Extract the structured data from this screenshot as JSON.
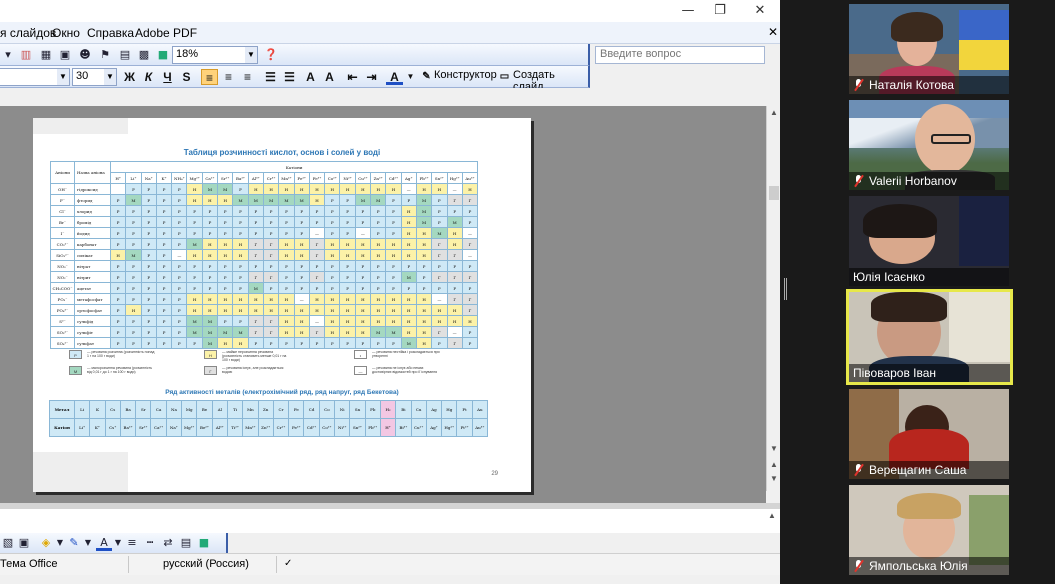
{
  "app": {
    "menu": [
      "я слайдов",
      "Окно",
      "Справка",
      "Adobe PDF"
    ],
    "help_placeholder": "Введите вопрос",
    "zoom": "18%",
    "font_size": "30",
    "designer_label": "Конструктор",
    "new_slide_label": "Создать слайд",
    "status": {
      "theme": "Тема Office",
      "language": "русский (Россия)"
    }
  },
  "slide": {
    "title": "Таблиця розчинності кислот, основ і солей у воді",
    "header_anion": "Аніони",
    "header_name": "Назва аніона",
    "header_cations": "Катіони",
    "cations": [
      "H⁺",
      "Li⁺",
      "Na⁺",
      "K⁺",
      "NH₄⁺",
      "Mg²⁺",
      "Ca²⁺",
      "Sr²⁺",
      "Ba²⁺",
      "Al³⁺",
      "Cr³⁺",
      "Mn²⁺",
      "Fe²⁺",
      "Fe³⁺",
      "Co²⁺",
      "Ni²⁺",
      "Cu²⁺",
      "Zn²⁺",
      "Cd²⁺",
      "Ag⁺",
      "Pb²⁺",
      "Sn²⁺",
      "Hg²⁺",
      "Au³⁺"
    ],
    "rows": [
      {
        "anion": "OH⁻",
        "name": "гідроксид",
        "cells": [
          "",
          "Р",
          "Р",
          "Р",
          "Р",
          "Н",
          "М",
          "М",
          "Р",
          "Н",
          "Н",
          "Н",
          "Н",
          "Н",
          "Н",
          "Н",
          "Н",
          "Н",
          "Н",
          "—",
          "Н",
          "Н",
          "—",
          "Н"
        ]
      },
      {
        "anion": "F⁻",
        "name": "фторид",
        "cells": [
          "Р",
          "М",
          "Р",
          "Р",
          "Р",
          "Н",
          "Н",
          "Н",
          "М",
          "М",
          "М",
          "М",
          "М",
          "Н",
          "Р",
          "Р",
          "М",
          "М",
          "Р",
          "Р",
          "М",
          "Р",
          "Г",
          "Г"
        ]
      },
      {
        "anion": "Cl⁻",
        "name": "хлорид",
        "cells": [
          "Р",
          "Р",
          "Р",
          "Р",
          "Р",
          "Р",
          "Р",
          "Р",
          "Р",
          "Р",
          "Р",
          "Р",
          "Р",
          "Р",
          "Р",
          "Р",
          "Р",
          "Р",
          "Р",
          "Н",
          "М",
          "Р",
          "Р",
          "Р"
        ]
      },
      {
        "anion": "Br⁻",
        "name": "бромід",
        "cells": [
          "Р",
          "Р",
          "Р",
          "Р",
          "Р",
          "Р",
          "Р",
          "Р",
          "Р",
          "Р",
          "Р",
          "Р",
          "Р",
          "Р",
          "Р",
          "Р",
          "Р",
          "Р",
          "Р",
          "Н",
          "М",
          "Р",
          "М",
          "Р"
        ]
      },
      {
        "anion": "I⁻",
        "name": "йодид",
        "cells": [
          "Р",
          "Р",
          "Р",
          "Р",
          "Р",
          "Р",
          "Р",
          "Р",
          "Р",
          "Р",
          "Р",
          "Р",
          "Р",
          "—",
          "Р",
          "Р",
          "—",
          "Р",
          "Р",
          "Н",
          "Н",
          "М",
          "Н",
          "—"
        ]
      },
      {
        "anion": "CO₃²⁻",
        "name": "карбонат",
        "cells": [
          "Р",
          "Р",
          "Р",
          "Р",
          "Р",
          "М",
          "Н",
          "Н",
          "Н",
          "Г",
          "Г",
          "Н",
          "Н",
          "Г",
          "Н",
          "Н",
          "Н",
          "Н",
          "Н",
          "Н",
          "Н",
          "Г",
          "Н",
          "Г"
        ]
      },
      {
        "anion": "SiO₃²⁻",
        "name": "силікат",
        "cells": [
          "Н",
          "М",
          "Р",
          "Р",
          "—",
          "Н",
          "Н",
          "Н",
          "Н",
          "Г",
          "Г",
          "Н",
          "Н",
          "Г",
          "Н",
          "Н",
          "Н",
          "Н",
          "Н",
          "Н",
          "Н",
          "Г",
          "Г",
          "—"
        ]
      },
      {
        "anion": "NO₃⁻",
        "name": "нітрат",
        "cells": [
          "Р",
          "Р",
          "Р",
          "Р",
          "Р",
          "Р",
          "Р",
          "Р",
          "Р",
          "Р",
          "Р",
          "Р",
          "Р",
          "Р",
          "Р",
          "Р",
          "Р",
          "Р",
          "Р",
          "Р",
          "Р",
          "Р",
          "Р",
          "Р"
        ]
      },
      {
        "anion": "NO₂⁻",
        "name": "нітрит",
        "cells": [
          "Р",
          "Р",
          "Р",
          "Р",
          "Р",
          "Р",
          "Р",
          "Р",
          "Р",
          "Г",
          "Г",
          "Р",
          "Р",
          "Г",
          "Р",
          "Р",
          "Р",
          "Р",
          "Р",
          "М",
          "Р",
          "Г",
          "Г",
          "Г"
        ]
      },
      {
        "anion": "CH₃COO⁻",
        "name": "ацетат",
        "cells": [
          "Р",
          "Р",
          "Р",
          "Р",
          "Р",
          "Р",
          "Р",
          "Р",
          "Р",
          "М",
          "Р",
          "Р",
          "Р",
          "Р",
          "Р",
          "Р",
          "Р",
          "Р",
          "Р",
          "Р",
          "Р",
          "Р",
          "Р",
          "Р"
        ]
      },
      {
        "anion": "PO₃⁻",
        "name": "метафосфат",
        "cells": [
          "Р",
          "Р",
          "Р",
          "Р",
          "Р",
          "Н",
          "Н",
          "Н",
          "Н",
          "Н",
          "Н",
          "Н",
          "—",
          "Н",
          "Н",
          "Н",
          "Н",
          "Н",
          "Н",
          "Н",
          "Н",
          "—",
          "Г",
          "Г"
        ]
      },
      {
        "anion": "PO₄³⁻",
        "name": "ортофосфат",
        "cells": [
          "Р",
          "Н",
          "Р",
          "Р",
          "Р",
          "Н",
          "Н",
          "Н",
          "Н",
          "Н",
          "Н",
          "Н",
          "Н",
          "Н",
          "Н",
          "Н",
          "Н",
          "Н",
          "Н",
          "Н",
          "Н",
          "Н",
          "Н",
          "Г"
        ]
      },
      {
        "anion": "S²⁻",
        "name": "сульфід",
        "cells": [
          "Р",
          "Р",
          "Р",
          "Р",
          "Р",
          "М",
          "М",
          "Р",
          "Р",
          "Г",
          "Г",
          "Н",
          "Н",
          "—",
          "Н",
          "Н",
          "Н",
          "Н",
          "Н",
          "Н",
          "Н",
          "Н",
          "Н",
          "Н"
        ]
      },
      {
        "anion": "SO₃²⁻",
        "name": "сульфіт",
        "cells": [
          "Р",
          "Р",
          "Р",
          "Р",
          "Р",
          "М",
          "М",
          "М",
          "М",
          "Г",
          "Г",
          "Н",
          "Н",
          "Г",
          "Н",
          "Н",
          "Н",
          "М",
          "М",
          "Н",
          "Н",
          "Г",
          "—",
          "Р"
        ]
      },
      {
        "anion": "SO₄²⁻",
        "name": "сульфат",
        "cells": [
          "Р",
          "Р",
          "Р",
          "Р",
          "Р",
          "Р",
          "М",
          "Н",
          "Н",
          "Р",
          "Р",
          "Р",
          "Р",
          "Р",
          "Р",
          "Р",
          "Р",
          "Р",
          "Р",
          "М",
          "Н",
          "Р",
          "Г",
          "Р"
        ]
      }
    ],
    "legend": [
      {
        "sym": "Р",
        "text": "— речовина розчинна (розчинність понад 1 г на 100 г води)"
      },
      {
        "sym": "М",
        "text": "— малорозчинна речовина (розчинність від 0,01 г до 1 г на 100 г води)"
      },
      {
        "sym": "Н",
        "text": "— майже нерозчинна речовина (розчинність становить менше 0,01 г на 100 г води)"
      },
      {
        "sym": "Г",
        "text": "— речовина існує, але розкладається водою"
      },
      {
        "sym": "•",
        "text": "— речовина нестійка і розкладається при утворенні"
      },
      {
        "sym": "—",
        "text": "— речовина не існує або немає достовірних відомостей про її існування"
      }
    ],
    "metals_title": "Ряд активності металів (електрохімічний ряд, ряд напруг, ряд Бекетова)",
    "metal_label": "Метал",
    "cation_label": "Катіон",
    "metals": [
      "Li",
      "K",
      "Cs",
      "Ba",
      "Sr",
      "Ca",
      "Na",
      "Mg",
      "Be",
      "Al",
      "Ti",
      "Mn",
      "Zn",
      "Cr",
      "Fe",
      "Cd",
      "Co",
      "Ni",
      "Sn",
      "Pb",
      "H₂",
      "Bi",
      "Cu",
      "Ag",
      "Hg",
      "Pt",
      "Au"
    ],
    "metal_cations": [
      "Li⁺",
      "K⁺",
      "Cs⁺",
      "Ba²⁺",
      "Sr²⁺",
      "Ca²⁺",
      "Na⁺",
      "Mg²⁺",
      "Be²⁺",
      "Al³⁺",
      "Ti²⁺",
      "Mn²⁺",
      "Zn²⁺",
      "Cr²⁺",
      "Fe²⁺",
      "Cd²⁺",
      "Co²⁺",
      "Ni²⁺",
      "Sn²⁺",
      "Pb²⁺",
      "H⁺",
      "Bi³⁺",
      "Cu²⁺",
      "Ag⁺",
      "Hg²⁺",
      "Pt²⁺",
      "Au³⁺"
    ],
    "page_number": "29"
  },
  "participants": [
    {
      "name": "Наталія Котова",
      "muted": true,
      "active": false
    },
    {
      "name": "Valerii Horbanov",
      "muted": true,
      "active": false
    },
    {
      "name": "Юлія Ісаєнко",
      "muted": false,
      "active": false
    },
    {
      "name": "Півоваров Іван",
      "muted": false,
      "active": true
    },
    {
      "name": "Верещагин Саша",
      "muted": true,
      "active": false
    },
    {
      "name": "Ямпольська Юлія",
      "muted": true,
      "active": false
    }
  ]
}
